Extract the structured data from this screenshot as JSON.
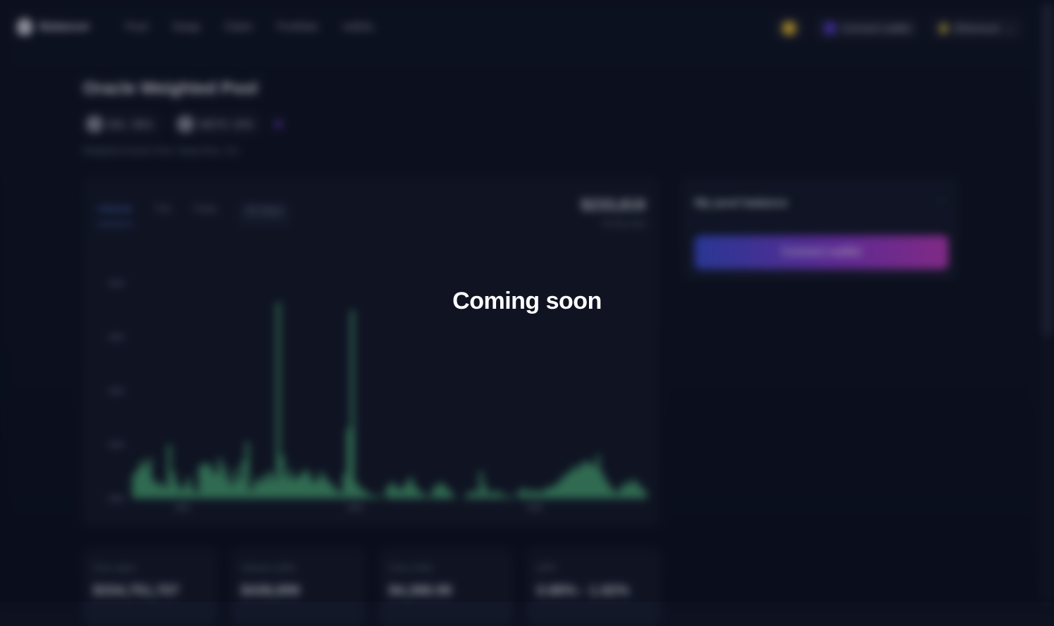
{
  "overlay": {
    "message": "Coming soon"
  },
  "nav": {
    "brand": "Balancer",
    "links": [
      "Pool",
      "Swap",
      "Claim",
      "Portfolio",
      "veBAL"
    ],
    "connect_wallet": "Connect wallet",
    "network": "Ethereum"
  },
  "pool": {
    "title": "Oracle Weighted Pool",
    "tokens": [
      {
        "symbol": "BAL",
        "weight": "80%"
      },
      {
        "symbol": "WETH",
        "weight": "20%"
      }
    ],
    "description": "Weighted Oracle Pool. Swap fees: 1%"
  },
  "chart_tabs": {
    "tabs": [
      "Volume",
      "TVL",
      "Fees"
    ],
    "range": "30 days",
    "value": "$233,819",
    "value_sub": "30 day total"
  },
  "side_panel": {
    "title": "My pool balance",
    "button": "Connect wallet"
  },
  "stats": [
    {
      "label": "Pool value",
      "value": "$334,751,707"
    },
    {
      "label": "Volume (24h)",
      "value": "$438,899"
    },
    {
      "label": "Fees (24h)",
      "value": "$4,388.99"
    },
    {
      "label": "APR",
      "value": "0.88% - 1.92%"
    }
  ],
  "colors": {
    "accent": "#5b8def",
    "bar": "#4caf7a",
    "button_start": "#3b4fd8",
    "button_end": "#c23bc2"
  },
  "chart_data": {
    "type": "bar",
    "values": [
      0.9,
      1.1,
      1.4,
      1.2,
      1.5,
      0.7,
      0.5,
      0.6,
      0.4,
      2.0,
      1.0,
      0.6,
      0.3,
      0.5,
      0.8,
      0.4,
      0.2,
      1.2,
      1.3,
      1.3,
      1.1,
      0.9,
      1.5,
      1.2,
      0.8,
      0.5,
      1.1,
      0.7,
      1.4,
      2.1,
      0.3,
      0.6,
      0.8,
      0.6,
      0.9,
      1.0,
      0.7,
      7.3,
      1.6,
      0.8,
      1.1,
      0.7,
      0.8,
      0.9,
      1.1,
      0.9,
      0.6,
      0.7,
      1.0,
      0.8,
      0.6,
      0.5,
      0.3,
      0.2,
      0.9,
      2.6,
      7.0,
      0.6,
      0.4,
      0.3,
      0.2,
      0.1,
      0.1,
      0.1,
      0.0,
      0.4,
      0.6,
      0.5,
      0.3,
      0.4,
      0.6,
      0.8,
      0.5,
      0.3,
      0.2,
      0.1,
      0.1,
      0.4,
      0.5,
      0.6,
      0.4,
      0.3,
      0.1,
      0.0,
      0.0,
      0.1,
      0.2,
      0.3,
      0.2,
      1.0,
      0.5,
      0.2,
      0.2,
      0.3,
      0.2,
      0.1,
      0.1,
      0.1,
      0.0,
      0.3,
      0.4,
      0.2,
      0.3,
      0.3,
      0.2,
      0.3,
      0.4,
      0.4,
      0.5,
      0.6,
      0.8,
      0.9,
      1.0,
      1.2,
      1.1,
      1.3,
      1.4,
      1.3,
      1.2,
      1.6,
      1.0,
      0.7,
      0.5,
      0.3,
      0.2,
      0.4,
      0.6,
      0.5,
      0.7,
      0.6,
      0.4,
      0.3
    ],
    "ylim": [
      0,
      8
    ]
  }
}
